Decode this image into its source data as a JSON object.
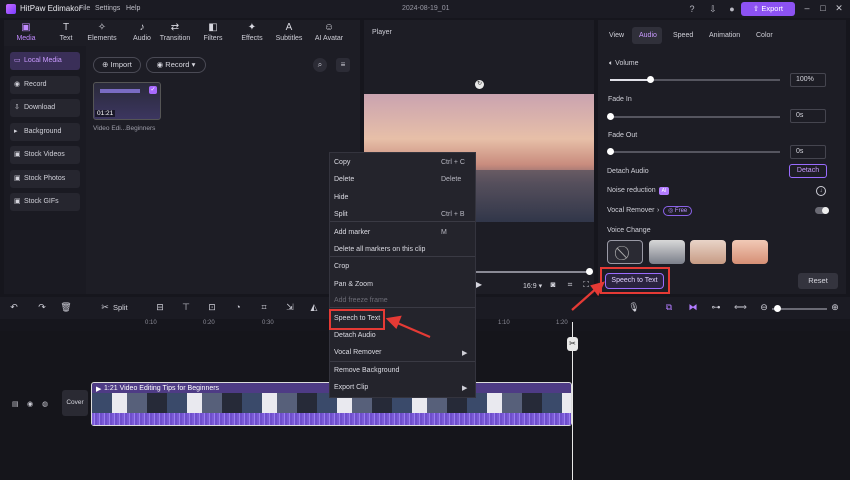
{
  "titlebar": {
    "app_name": "HitPaw Edimakor",
    "menus": [
      "File",
      "Settings",
      "Help"
    ],
    "document_title": "2024-08-19_01",
    "export_label": "Export"
  },
  "toolbar": {
    "tools": [
      {
        "label": "Media",
        "icon": "media-icon",
        "glyph": "▣"
      },
      {
        "label": "Text",
        "icon": "text-icon",
        "glyph": "T"
      },
      {
        "label": "Elements",
        "icon": "elements-icon",
        "glyph": "✧"
      },
      {
        "label": "Audio",
        "icon": "music-note-icon",
        "glyph": "♪"
      },
      {
        "label": "Transition",
        "icon": "transition-icon",
        "glyph": "⇄"
      },
      {
        "label": "Filters",
        "icon": "filters-icon",
        "glyph": "◧"
      },
      {
        "label": "Effects",
        "icon": "effects-icon",
        "glyph": "✦"
      },
      {
        "label": "Subtitles",
        "icon": "subtitles-icon",
        "glyph": "A"
      },
      {
        "label": "AI Avatar",
        "icon": "ai-avatar-icon",
        "glyph": "☺"
      }
    ]
  },
  "sidebar": {
    "items": [
      {
        "label": "Local Media",
        "icon": "folder-icon"
      },
      {
        "label": "Record",
        "icon": "record-icon"
      },
      {
        "label": "Download",
        "icon": "download-icon"
      },
      {
        "label": "Background",
        "icon": "background-icon"
      },
      {
        "label": "Stock Videos",
        "icon": "video-icon"
      },
      {
        "label": "Stock Photos",
        "icon": "photo-icon"
      },
      {
        "label": "Stock GIFs",
        "icon": "gif-icon"
      }
    ]
  },
  "media": {
    "import_label": "Import",
    "record_label": "Record",
    "thumbnail_duration": "01:21",
    "thumbnail_name": "Video Edi...Beginners"
  },
  "player": {
    "title": "Player",
    "aspect_ratio": "16:9"
  },
  "right_panel": {
    "tabs": [
      "View",
      "Audio",
      "Speed",
      "Animation",
      "Color"
    ],
    "volume_label": "Volume",
    "volume_value": "100%",
    "volume_level": 0.75,
    "fade_in_label": "Fade In",
    "fade_in_value": "0s",
    "fade_out_label": "Fade Out",
    "fade_out_value": "0s",
    "detach_audio_label": "Detach Audio",
    "detach_button": "Detach",
    "noise_reduction_label": "Noise reduction",
    "vocal_remover_label": "Vocal Remover",
    "vocal_remover_badge": "Free",
    "voice_change_label": "Voice Change",
    "speech_to_text_button": "Speech to Text",
    "reset_button": "Reset"
  },
  "timeline": {
    "split_label": "Split",
    "ruler_ticks": [
      "0:10",
      "0:20",
      "0:30",
      "1:10",
      "1:20"
    ],
    "cover_label": "Cover",
    "clip_title": "1:21  Video Editing Tips for Beginners"
  },
  "context_menu": {
    "items": [
      {
        "label": "Copy",
        "shortcut": "Ctrl + C"
      },
      {
        "label": "Delete",
        "shortcut": "Delete"
      },
      {
        "label": "Hide",
        "shortcut": ""
      },
      {
        "label": "Split",
        "shortcut": "Ctrl + B"
      },
      {
        "label": "Add marker",
        "shortcut": "M"
      },
      {
        "label": "Delete all markers on this clip",
        "shortcut": ""
      },
      {
        "label": "Crop",
        "shortcut": ""
      },
      {
        "label": "Pan & Zoom",
        "shortcut": ""
      },
      {
        "label": "Add freeze frame",
        "shortcut": ""
      },
      {
        "label": "Speech to Text",
        "shortcut": ""
      },
      {
        "label": "Detach Audio",
        "shortcut": ""
      },
      {
        "label": "Vocal Remover",
        "shortcut": ""
      },
      {
        "label": "Remove Background",
        "shortcut": ""
      },
      {
        "label": "Export Clip",
        "shortcut": ""
      }
    ]
  },
  "colors": {
    "accent": "#8c52f2",
    "highlight_red": "#e53a35"
  }
}
